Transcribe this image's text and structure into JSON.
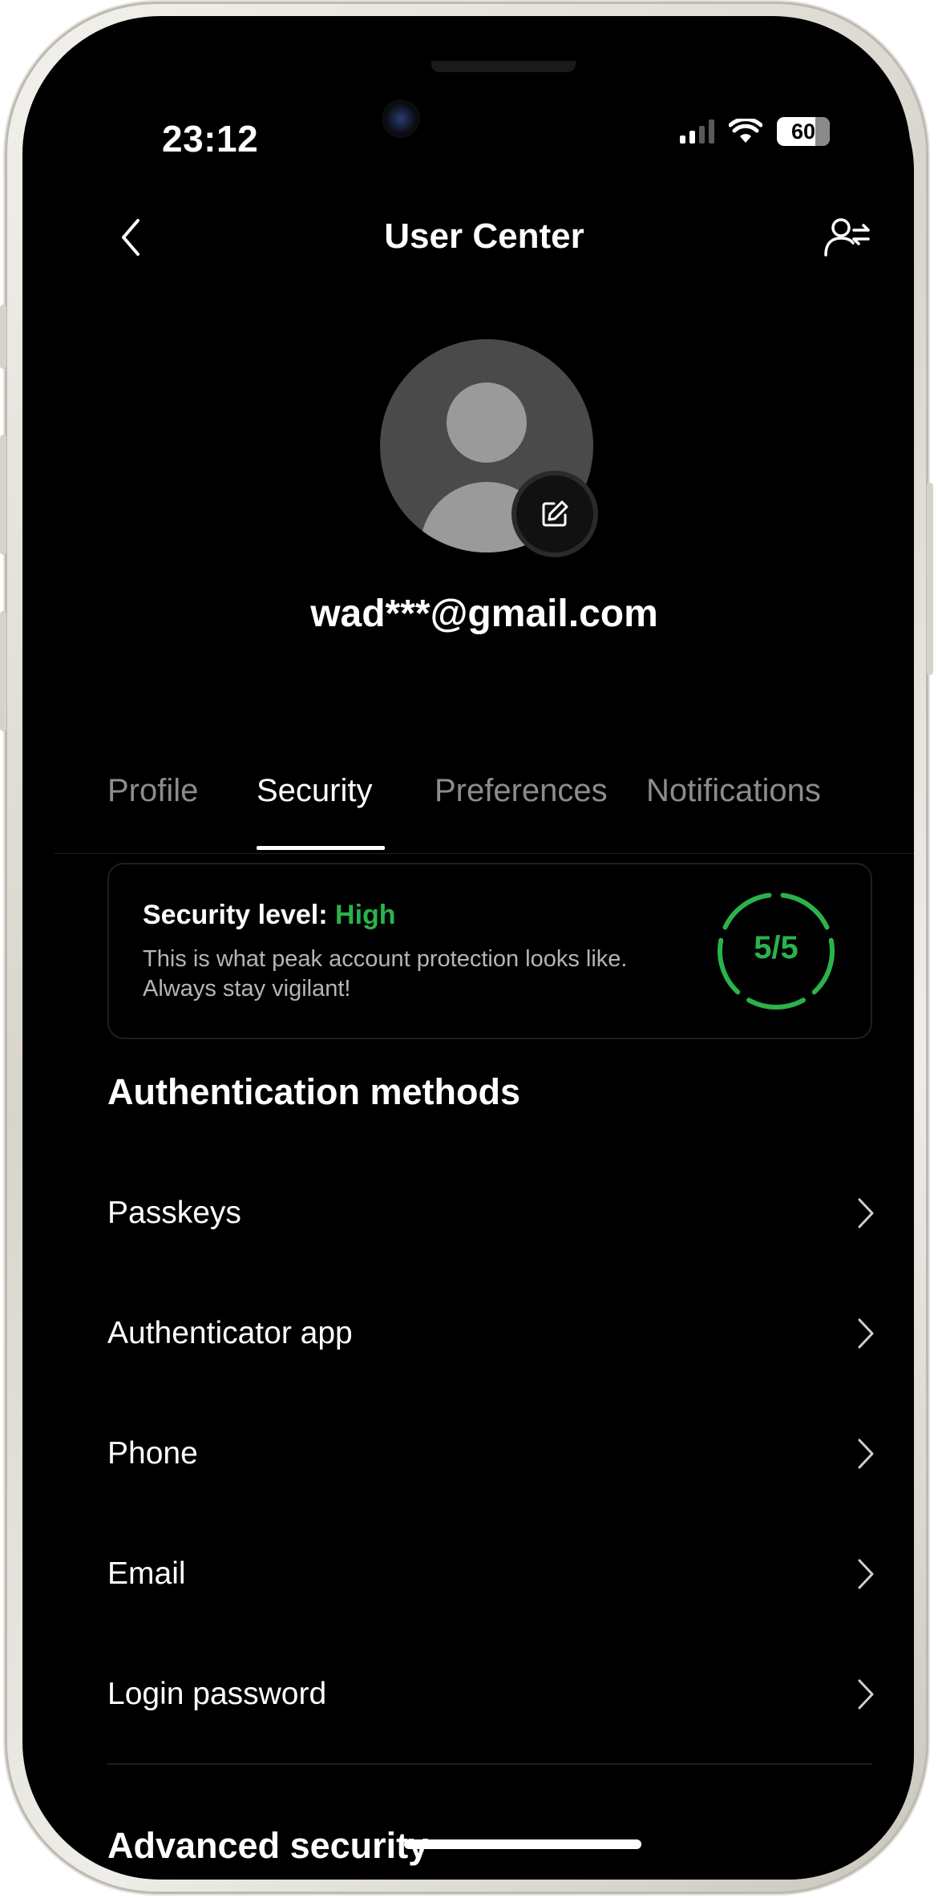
{
  "status_bar": {
    "time": "23:12",
    "battery": "60"
  },
  "header": {
    "title": "User Center",
    "back_icon": "chevron-left-icon",
    "switch_account_icon": "user-switch-icon"
  },
  "profile": {
    "avatar_icon": "default-avatar-icon",
    "edit_icon": "edit-icon",
    "email": "wad***@gmail.com"
  },
  "tabs": [
    {
      "label": "Profile",
      "active": false
    },
    {
      "label": "Security",
      "active": true
    },
    {
      "label": "Preferences",
      "active": false
    },
    {
      "label": "Notifications",
      "active": false
    }
  ],
  "security_card": {
    "level_label": "Security level:",
    "level_value": "High",
    "description": "This is what peak account protection looks like. Always stay vigilant!",
    "score": "5/5",
    "accent_color": "#2bb24c"
  },
  "auth_section": {
    "title": "Authentication methods",
    "items": [
      {
        "label": "Passkeys"
      },
      {
        "label": "Authenticator app"
      },
      {
        "label": "Phone"
      },
      {
        "label": "Email"
      },
      {
        "label": "Login password"
      }
    ]
  },
  "advanced_section": {
    "title": "Advanced security"
  }
}
